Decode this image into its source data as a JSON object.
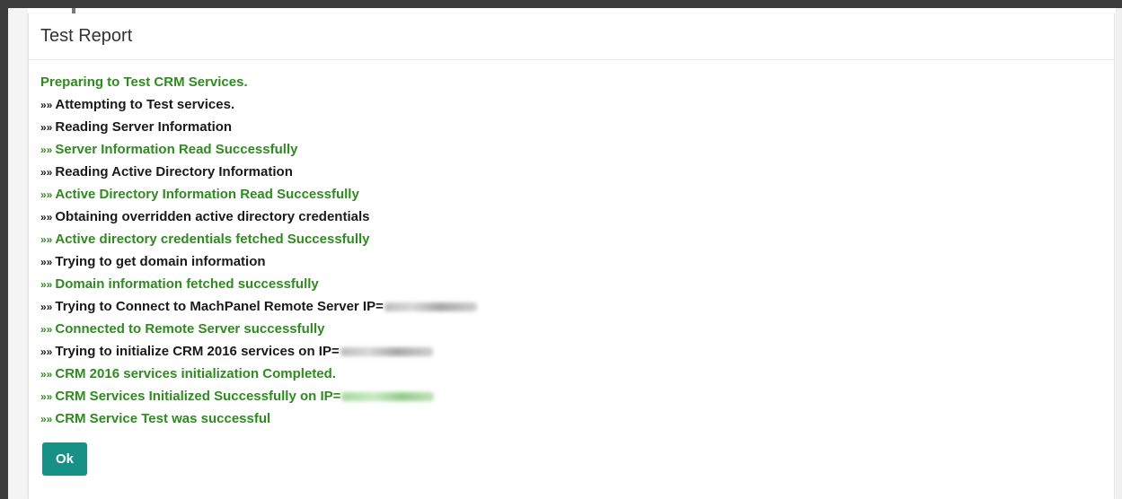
{
  "dialog": {
    "title": "Test Report",
    "ok_label": "Ok"
  },
  "log": {
    "arrow": "»»",
    "lines": [
      {
        "text": "Preparing to Test CRM Services.",
        "status": "success",
        "prefix": false
      },
      {
        "text": "Attempting to Test services.",
        "status": "info",
        "prefix": true
      },
      {
        "text": "Reading Server Information",
        "status": "info",
        "prefix": true
      },
      {
        "text": "Server Information Read Successfully",
        "status": "success",
        "prefix": true
      },
      {
        "text": "Reading Active Directory Information",
        "status": "info",
        "prefix": true
      },
      {
        "text": "Active Directory Information Read Successfully",
        "status": "success",
        "prefix": true
      },
      {
        "text": "Obtaining overridden active directory credentials",
        "status": "info",
        "prefix": true
      },
      {
        "text": "Active directory credentials fetched Successfully",
        "status": "success",
        "prefix": true
      },
      {
        "text": "Trying to get domain information",
        "status": "info",
        "prefix": true
      },
      {
        "text": "Domain information fetched successfully",
        "status": "success",
        "prefix": true
      },
      {
        "text": "Trying to Connect to MachPanel Remote Server IP=",
        "status": "info",
        "prefix": true,
        "redacted_ip": true
      },
      {
        "text": "Connected to Remote Server successfully",
        "status": "success",
        "prefix": true
      },
      {
        "text": "Trying to initialize CRM 2016 services on IP=",
        "status": "info",
        "prefix": true,
        "redacted_ip": true
      },
      {
        "text": "CRM 2016 services initialization Completed.",
        "status": "success",
        "prefix": true
      },
      {
        "text": "CRM Services Initialized Successfully on IP=",
        "status": "success",
        "prefix": true,
        "redacted_ip": true
      },
      {
        "text": "CRM Service Test was successful",
        "status": "success",
        "prefix": true
      }
    ]
  },
  "colors": {
    "success": "#2e8b1e",
    "info": "#1a1a1a",
    "button": "#179186"
  }
}
